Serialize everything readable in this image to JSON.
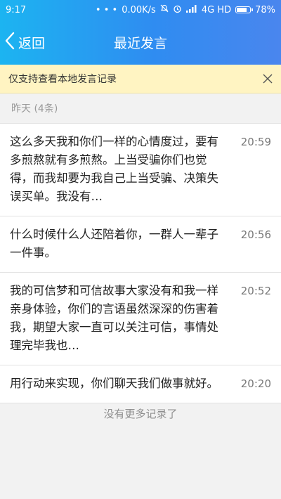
{
  "status_bar": {
    "time": "9:17",
    "dots": "• • •",
    "network_speed": "0.00K/s",
    "alarm_icon": "alarm-icon",
    "signal_icon": "signal-icon",
    "network_type": "4G HD",
    "battery_percent": "78%",
    "battery_level": 0.78
  },
  "nav": {
    "back_label": "返回",
    "title": "最近发言"
  },
  "notice": {
    "text": "仅支持查看本地发言记录"
  },
  "section": {
    "label": "昨天 (4条)"
  },
  "messages": [
    {
      "text": "这么多天我和你们一样的心情度过，要有多煎熬就有多煎熬。上当受骗你们也觉得，而我却要为我自己上当受骗、决策失误买单。我没有…",
      "time": "20:59"
    },
    {
      "text": "什么时候什么人还陪着你，一群人一辈子一件事。",
      "time": "20:56"
    },
    {
      "text": "我的可信梦和可信故事大家没有和我一样亲身体验，你们的言语虽然深深的伤害着我，期望大家一直可以关注可信，事情处理完毕我也…",
      "time": "20:52"
    },
    {
      "text": "用行动来实现，你们聊天我们做事就好。",
      "time": "20:20"
    }
  ],
  "footer": {
    "text": "没有更多记录了"
  },
  "colors": {
    "header_gradient_start": "#1cb4f1",
    "header_gradient_end": "#4a86ee",
    "notice_bg": "#fff4c2"
  }
}
